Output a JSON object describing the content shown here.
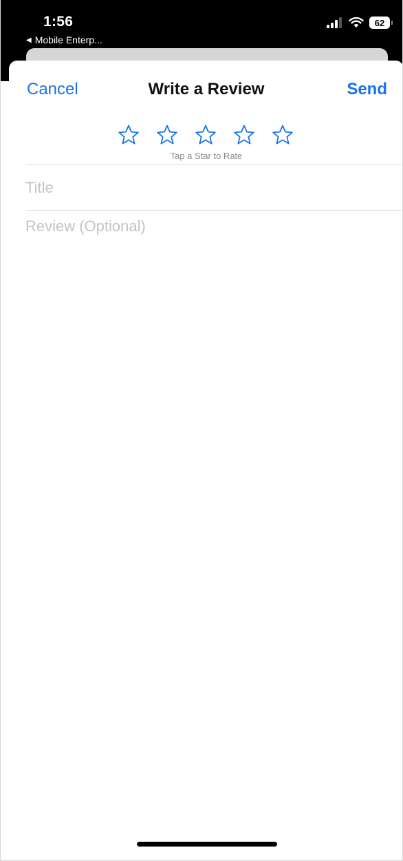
{
  "status_bar": {
    "time": "1:56",
    "back_app": "Mobile Enterp...",
    "battery_level": "62",
    "signal_icon": "cellular-signal-icon",
    "wifi_icon": "wifi-icon"
  },
  "nav": {
    "cancel_label": "Cancel",
    "title": "Write a Review",
    "send_label": "Send"
  },
  "rating": {
    "star_count": 5,
    "selected": 0,
    "hint": "Tap a Star to Rate",
    "star_color": "#1a73e8"
  },
  "form": {
    "title_placeholder": "Title",
    "title_value": "",
    "review_placeholder": "Review (Optional)",
    "review_value": ""
  },
  "colors": {
    "accent": "#1a73e8",
    "placeholder": "#c3c3c7"
  }
}
